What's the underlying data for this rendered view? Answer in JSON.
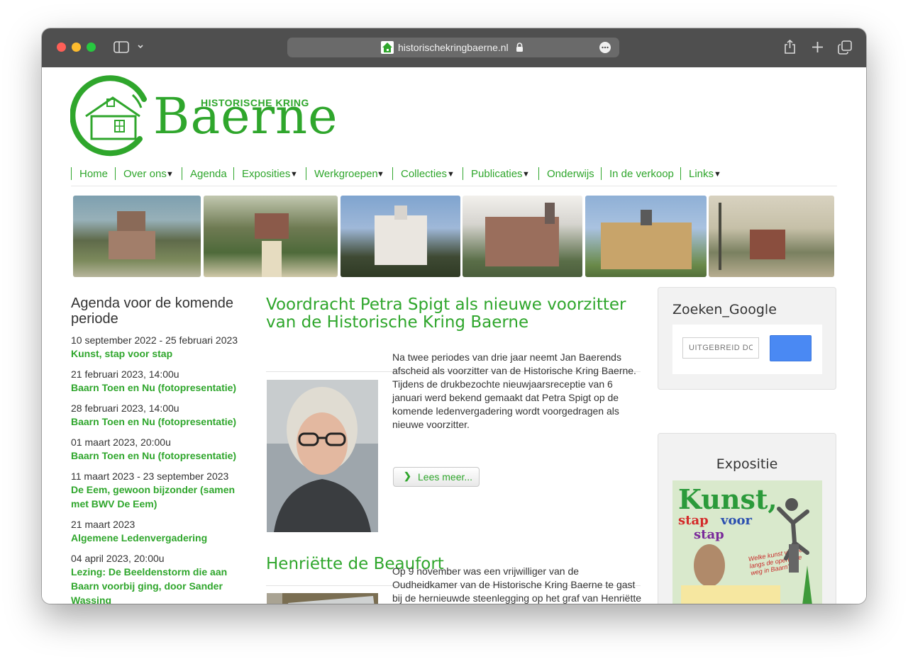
{
  "browser": {
    "url": "historischekringbaerne.nl"
  },
  "site": {
    "logo_subtitle": "HISTORISCHE KRING",
    "logo_title": "Baerne"
  },
  "nav": [
    {
      "label": "Home",
      "dropdown": false
    },
    {
      "label": "Over ons",
      "dropdown": true
    },
    {
      "label": "Agenda",
      "dropdown": false
    },
    {
      "label": "Exposities",
      "dropdown": true
    },
    {
      "label": "Werkgroepen",
      "dropdown": true
    },
    {
      "label": "Collecties",
      "dropdown": true
    },
    {
      "label": "Publicaties",
      "dropdown": true
    },
    {
      "label": "Onderwijs",
      "dropdown": false
    },
    {
      "label": "In de verkoop",
      "dropdown": false
    },
    {
      "label": "Links",
      "dropdown": true
    }
  ],
  "agenda": {
    "title": "Agenda voor de komende periode",
    "items": [
      {
        "date": "10 september 2022 - 25 februari 2023",
        "title": "Kunst, stap voor stap"
      },
      {
        "date": "21 februari 2023, 14:00u",
        "title": "Baarn Toen en Nu (fotopresentatie)"
      },
      {
        "date": "28 februari 2023, 14:00u",
        "title": "Baarn Toen en Nu (fotopresentatie)"
      },
      {
        "date": "01 maart 2023, 20:00u",
        "title": "Baarn Toen en Nu (fotopresentatie)"
      },
      {
        "date": "11 maart 2023 - 23 september 2023",
        "title": "De Eem, gewoon bijzonder (samen met BWV De Eem)"
      },
      {
        "date": "21 maart 2023",
        "title": "Algemene Ledenvergadering"
      },
      {
        "date": "04 april 2023, 20:00u",
        "title": "Lezing: De Beeldenstorm die aan Baarn voorbij ging, door Sander Wassing"
      }
    ]
  },
  "articles": [
    {
      "title": "Voordracht Petra Spigt als nieuwe voorzitter van de Historische Kring Baerne",
      "text": "Na twee periodes van drie jaar neemt Jan Baerends afscheid als voorzitter van de Historische Kring Baerne. Tijdens de drukbezochte nieuwjaarsreceptie van 6 januari werd bekend gemaakt dat Petra Spigt op de komende ledenvergadering wordt voorgedragen als nieuwe voorzitter.",
      "button": "Lees meer..."
    },
    {
      "title": "Henriëtte de Beaufort",
      "text": "Op 9 november was een vrijwilliger van de Oudheidkamer van de Historische Kring Baerne te gast bij de hernieuwde steenlegging op het graf van Henriëtte de"
    }
  ],
  "search_panel": {
    "title": "Zoeken_Google",
    "placeholder": "UITGEBREID DOORZOEKEN"
  },
  "expo_panel": {
    "title": "Expositie",
    "poster": {
      "line1": "Kunst,",
      "line2a": "stap",
      "line2b": "voor",
      "line3": "stap",
      "tagline": "Welke kunst vind je langs de openbare weg in Baarn?"
    }
  },
  "colors": {
    "brand_green": "#2fa62c",
    "search_button": "#4a89f3"
  }
}
